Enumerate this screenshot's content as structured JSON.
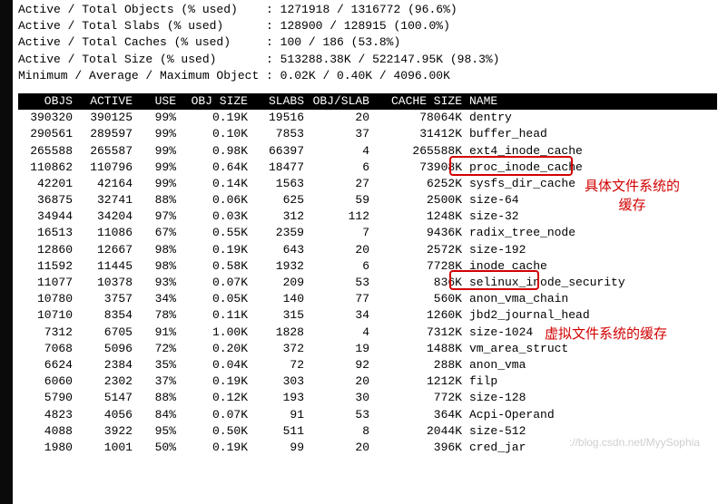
{
  "summary": [
    "Active / Total Objects (% used)    : 1271918 / 1316772 (96.6%)",
    "Active / Total Slabs (% used)      : 128900 / 128915 (100.0%)",
    "Active / Total Caches (% used)     : 100 / 186 (53.8%)",
    "Active / Total Size (% used)       : 513288.38K / 522147.95K (98.3%)",
    "Minimum / Average / Maximum Object : 0.02K / 0.40K / 4096.00K"
  ],
  "header": {
    "objs": "OBJS",
    "active": "ACTIVE",
    "use": "USE",
    "objsize": "OBJ SIZE",
    "slabs": "SLABS",
    "objslab": "OBJ/SLAB",
    "cache": "CACHE SIZE",
    "name": "NAME"
  },
  "rows": [
    {
      "objs": "390320",
      "active": "390125",
      "use": "99%",
      "objsize": "0.19K",
      "slabs": "19516",
      "objslab": "20",
      "cache": "78064K",
      "name": "dentry"
    },
    {
      "objs": "290561",
      "active": "289597",
      "use": "99%",
      "objsize": "0.10K",
      "slabs": "7853",
      "objslab": "37",
      "cache": "31412K",
      "name": "buffer_head"
    },
    {
      "objs": "265588",
      "active": "265587",
      "use": "99%",
      "objsize": "0.98K",
      "slabs": "66397",
      "objslab": "4",
      "cache": "265588K",
      "name": "ext4_inode_cache"
    },
    {
      "objs": "110862",
      "active": "110796",
      "use": "99%",
      "objsize": "0.64K",
      "slabs": "18477",
      "objslab": "6",
      "cache": "73908K",
      "name": "proc_inode_cache"
    },
    {
      "objs": "42201",
      "active": "42164",
      "use": "99%",
      "objsize": "0.14K",
      "slabs": "1563",
      "objslab": "27",
      "cache": "6252K",
      "name": "sysfs_dir_cache"
    },
    {
      "objs": "36875",
      "active": "32741",
      "use": "88%",
      "objsize": "0.06K",
      "slabs": "625",
      "objslab": "59",
      "cache": "2500K",
      "name": "size-64"
    },
    {
      "objs": "34944",
      "active": "34204",
      "use": "97%",
      "objsize": "0.03K",
      "slabs": "312",
      "objslab": "112",
      "cache": "1248K",
      "name": "size-32"
    },
    {
      "objs": "16513",
      "active": "11086",
      "use": "67%",
      "objsize": "0.55K",
      "slabs": "2359",
      "objslab": "7",
      "cache": "9436K",
      "name": "radix_tree_node"
    },
    {
      "objs": "12860",
      "active": "12667",
      "use": "98%",
      "objsize": "0.19K",
      "slabs": "643",
      "objslab": "20",
      "cache": "2572K",
      "name": "size-192"
    },
    {
      "objs": "11592",
      "active": "11445",
      "use": "98%",
      "objsize": "0.58K",
      "slabs": "1932",
      "objslab": "6",
      "cache": "7728K",
      "name": "inode_cache"
    },
    {
      "objs": "11077",
      "active": "10378",
      "use": "93%",
      "objsize": "0.07K",
      "slabs": "209",
      "objslab": "53",
      "cache": "836K",
      "name": "selinux_inode_security"
    },
    {
      "objs": "10780",
      "active": "3757",
      "use": "34%",
      "objsize": "0.05K",
      "slabs": "140",
      "objslab": "77",
      "cache": "560K",
      "name": "anon_vma_chain"
    },
    {
      "objs": "10710",
      "active": "8354",
      "use": "78%",
      "objsize": "0.11K",
      "slabs": "315",
      "objslab": "34",
      "cache": "1260K",
      "name": "jbd2_journal_head"
    },
    {
      "objs": "7312",
      "active": "6705",
      "use": "91%",
      "objsize": "1.00K",
      "slabs": "1828",
      "objslab": "4",
      "cache": "7312K",
      "name": "size-1024"
    },
    {
      "objs": "7068",
      "active": "5096",
      "use": "72%",
      "objsize": "0.20K",
      "slabs": "372",
      "objslab": "19",
      "cache": "1488K",
      "name": "vm_area_struct"
    },
    {
      "objs": "6624",
      "active": "2384",
      "use": "35%",
      "objsize": "0.04K",
      "slabs": "72",
      "objslab": "92",
      "cache": "288K",
      "name": "anon_vma"
    },
    {
      "objs": "6060",
      "active": "2302",
      "use": "37%",
      "objsize": "0.19K",
      "slabs": "303",
      "objslab": "20",
      "cache": "1212K",
      "name": "filp"
    },
    {
      "objs": "5790",
      "active": "5147",
      "use": "88%",
      "objsize": "0.12K",
      "slabs": "193",
      "objslab": "30",
      "cache": "772K",
      "name": "size-128"
    },
    {
      "objs": "4823",
      "active": "4056",
      "use": "84%",
      "objsize": "0.07K",
      "slabs": "91",
      "objslab": "53",
      "cache": "364K",
      "name": "Acpi-Operand"
    },
    {
      "objs": "4088",
      "active": "3922",
      "use": "95%",
      "objsize": "0.50K",
      "slabs": "511",
      "objslab": "8",
      "cache": "2044K",
      "name": "size-512"
    },
    {
      "objs": "1980",
      "active": "1001",
      "use": "50%",
      "objsize": "0.19K",
      "slabs": "99",
      "objslab": "20",
      "cache": "396K",
      "name": "cred_jar"
    }
  ],
  "annotations": {
    "a1": "具体文件系统的\n缓存",
    "a2": "虚拟文件系统的缓存"
  },
  "watermark": "://blog.csdn.net/MyySophia"
}
